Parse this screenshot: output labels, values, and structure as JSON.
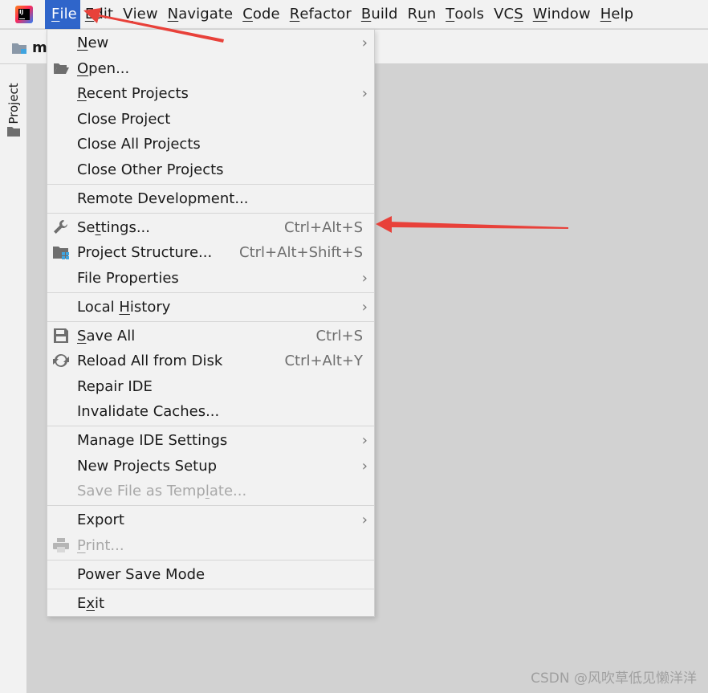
{
  "menubar": {
    "items": [
      {
        "pre": "",
        "u": "F",
        "post": "ile"
      },
      {
        "pre": "",
        "u": "E",
        "post": "dit"
      },
      {
        "pre": "",
        "u": "V",
        "post": "iew"
      },
      {
        "pre": "",
        "u": "N",
        "post": "avigate"
      },
      {
        "pre": "",
        "u": "C",
        "post": "ode"
      },
      {
        "pre": "",
        "u": "R",
        "post": "efactor"
      },
      {
        "pre": "",
        "u": "B",
        "post": "uild"
      },
      {
        "pre": "R",
        "u": "u",
        "post": "n"
      },
      {
        "pre": "",
        "u": "T",
        "post": "ools"
      },
      {
        "pre": "VC",
        "u": "S",
        "post": ""
      },
      {
        "pre": "",
        "u": "W",
        "post": "indow"
      },
      {
        "pre": "",
        "u": "H",
        "post": "elp"
      }
    ]
  },
  "toolbar": {
    "project_name": "m"
  },
  "leftstrip": {
    "project_tab": "Project"
  },
  "file_menu": {
    "new": {
      "u": "N",
      "rest": "ew"
    },
    "open": {
      "u": "O",
      "rest": "pen..."
    },
    "recent": {
      "u": "R",
      "rest": "ecent Projects"
    },
    "close_project": "Close Project",
    "close_all": "Close All Projects",
    "close_other": "Close Other Projects",
    "remote": "Remote Development...",
    "settings": {
      "pre": "Se",
      "u": "t",
      "post": "tings...",
      "shortcut": "Ctrl+Alt+S"
    },
    "project_structure": {
      "label": "Project Structure...",
      "shortcut": "Ctrl+Alt+Shift+S"
    },
    "file_properties": "File Properties",
    "local_history": {
      "pre": "Local ",
      "u": "H",
      "post": "istory"
    },
    "save_all": {
      "u": "S",
      "rest": "ave All",
      "shortcut": "Ctrl+S"
    },
    "reload": {
      "label": "Reload All from Disk",
      "shortcut": "Ctrl+Alt+Y"
    },
    "repair": "Repair IDE",
    "invalidate": "Invalidate Caches...",
    "manage_settings": "Manage IDE Settings",
    "new_projects_setup": "New Projects Setup",
    "save_template": {
      "pre": "Save File as Temp",
      "u": "l",
      "post": "ate..."
    },
    "export": "Export",
    "print": {
      "u": "P",
      "rest": "rint..."
    },
    "power_save": "Power Save Mode",
    "exit": {
      "pre": "E",
      "u": "x",
      "post": "it"
    }
  },
  "watermark": "CSDN @风吹草低见懒洋洋",
  "colors": {
    "menu_active": "#2f65ca",
    "arrow": "#e8413a"
  }
}
